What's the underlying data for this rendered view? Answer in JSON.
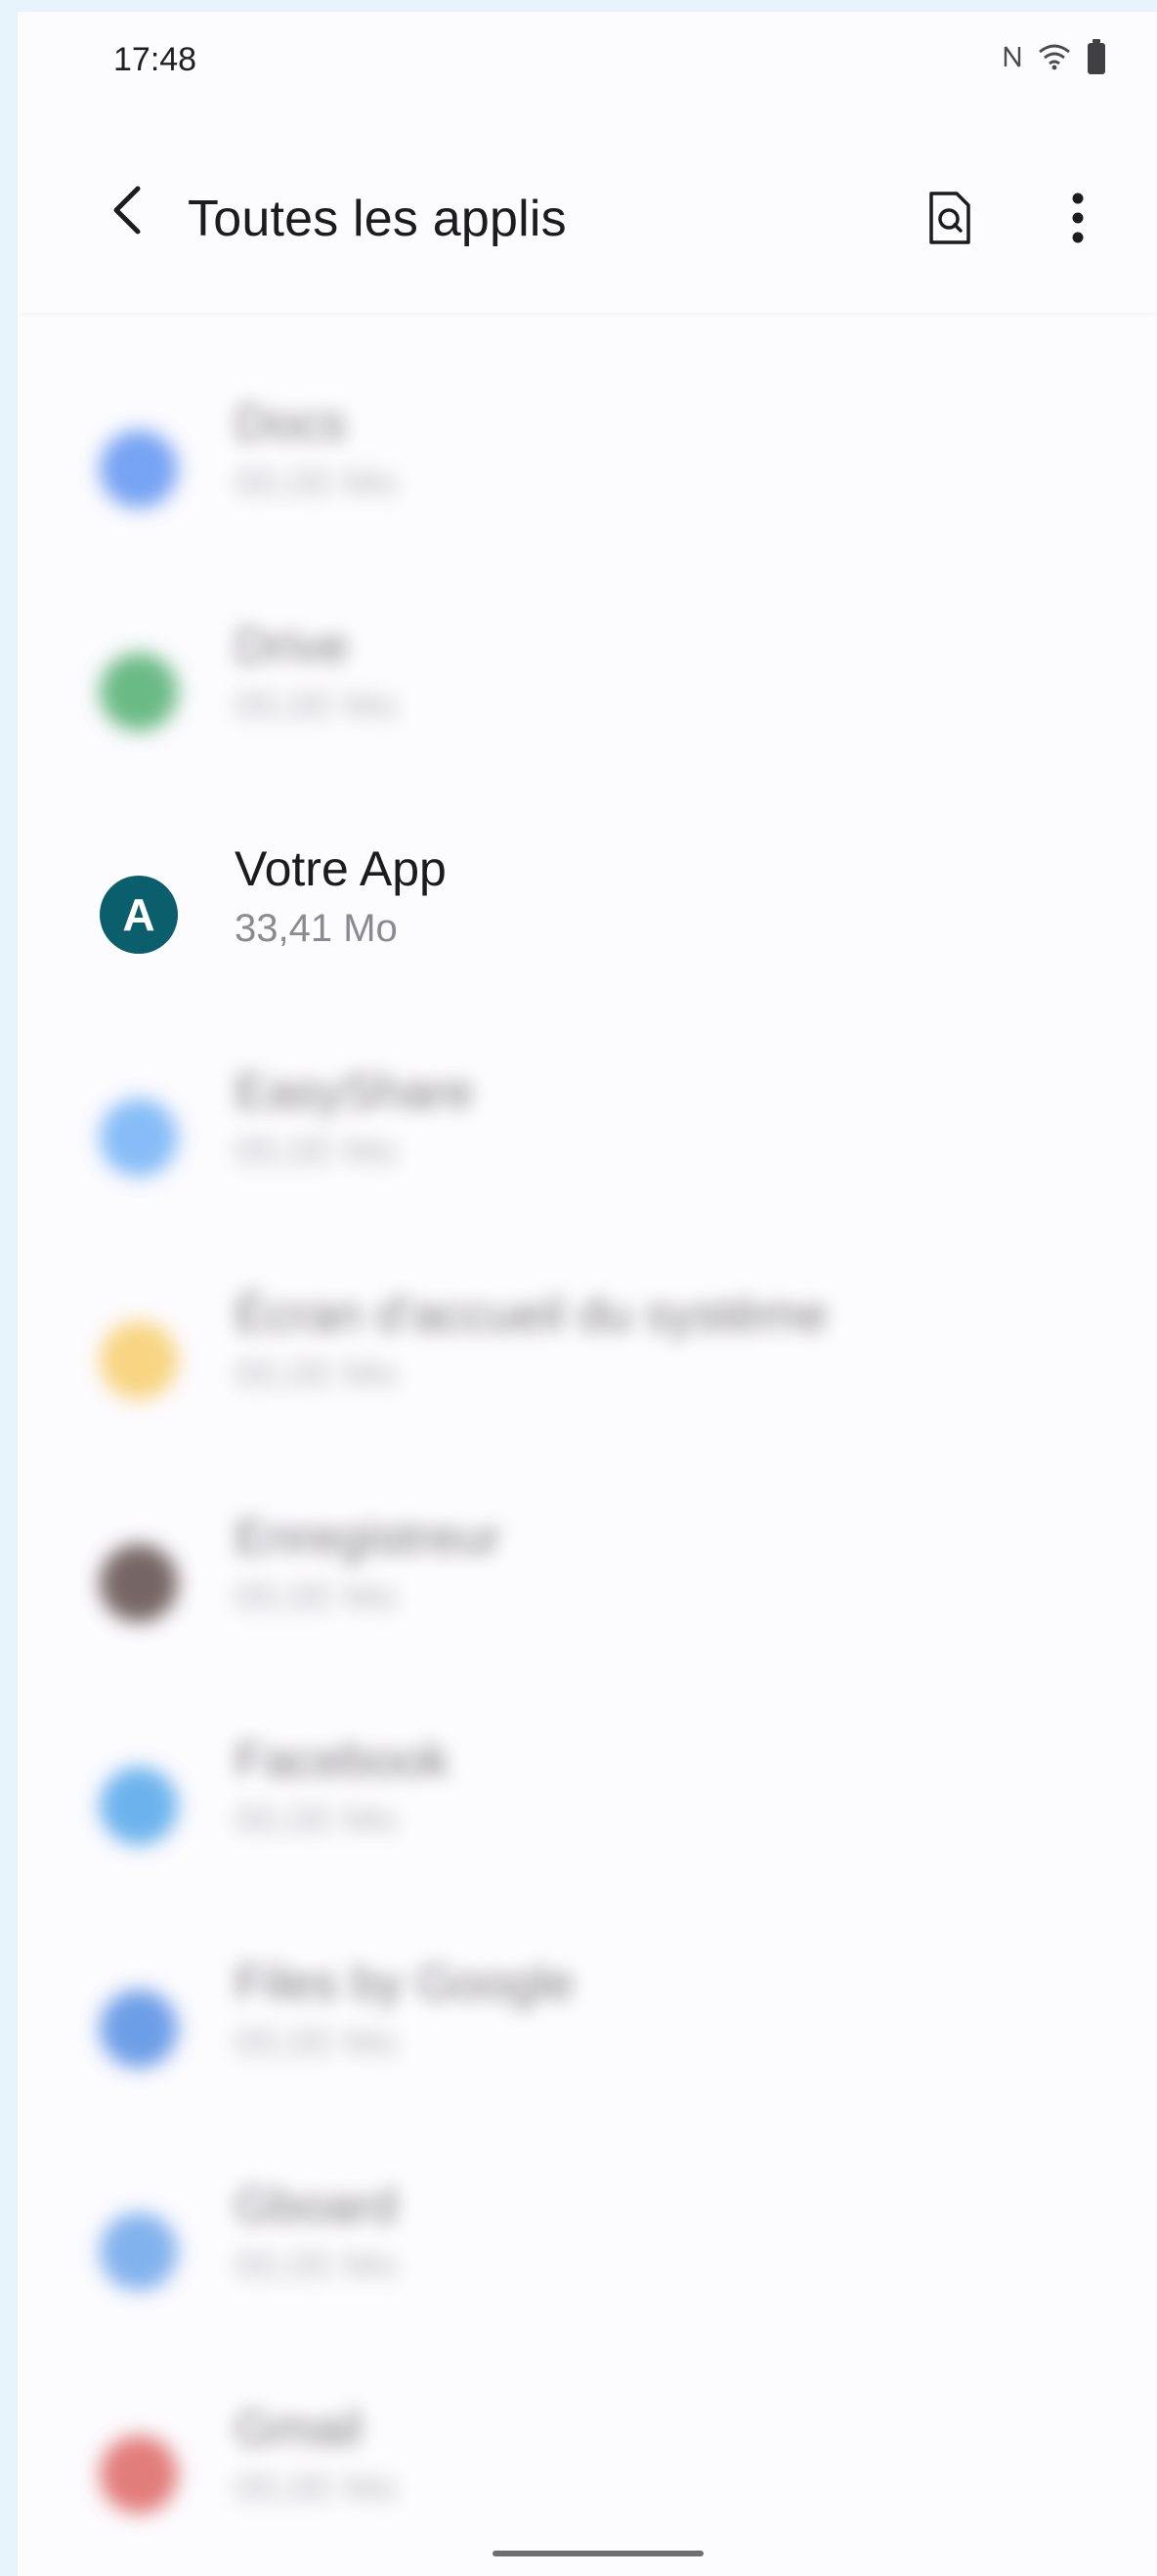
{
  "status_bar": {
    "time": "17:48",
    "icons": [
      "nfc-icon",
      "wifi-icon",
      "battery-icon"
    ]
  },
  "app_bar": {
    "title": "Toutes les applis",
    "back_icon": "back-arrow-icon",
    "search_icon": "search-document-icon",
    "more_icon": "more-vert-icon"
  },
  "apps": [
    {
      "name": "",
      "size": "",
      "icon_color": "#5b7be8",
      "blurred": true
    },
    {
      "name": "Docs",
      "size": "",
      "icon_color": "#4a86f0",
      "blurred": true
    },
    {
      "name": "Drive",
      "size": "",
      "icon_color": "#3aa55e",
      "blurred": true
    },
    {
      "name": "Votre App",
      "size": "33,41 Mo",
      "icon_letter": "A",
      "icon_color": "#0b5e6b",
      "blurred": false
    },
    {
      "name": "EasyShare",
      "size": "",
      "icon_color": "#5fa8f5",
      "blurred": true
    },
    {
      "name": "Écran d'accueil du système",
      "size": "",
      "icon_color": "#f7c85a",
      "blurred": true
    },
    {
      "name": "Enregistreur",
      "size": "",
      "icon_color": "#4a3432",
      "blurred": true
    },
    {
      "name": "Facebook",
      "size": "",
      "icon_color": "#3c9be8",
      "blurred": true
    },
    {
      "name": "Files by Google",
      "size": "",
      "icon_color": "#3d7fe0",
      "blurred": true
    },
    {
      "name": "Gboard",
      "size": "",
      "icon_color": "#5a9ae8",
      "blurred": true
    },
    {
      "name": "Gmail",
      "size": "",
      "icon_color": "#d9534f",
      "blurred": true
    }
  ]
}
